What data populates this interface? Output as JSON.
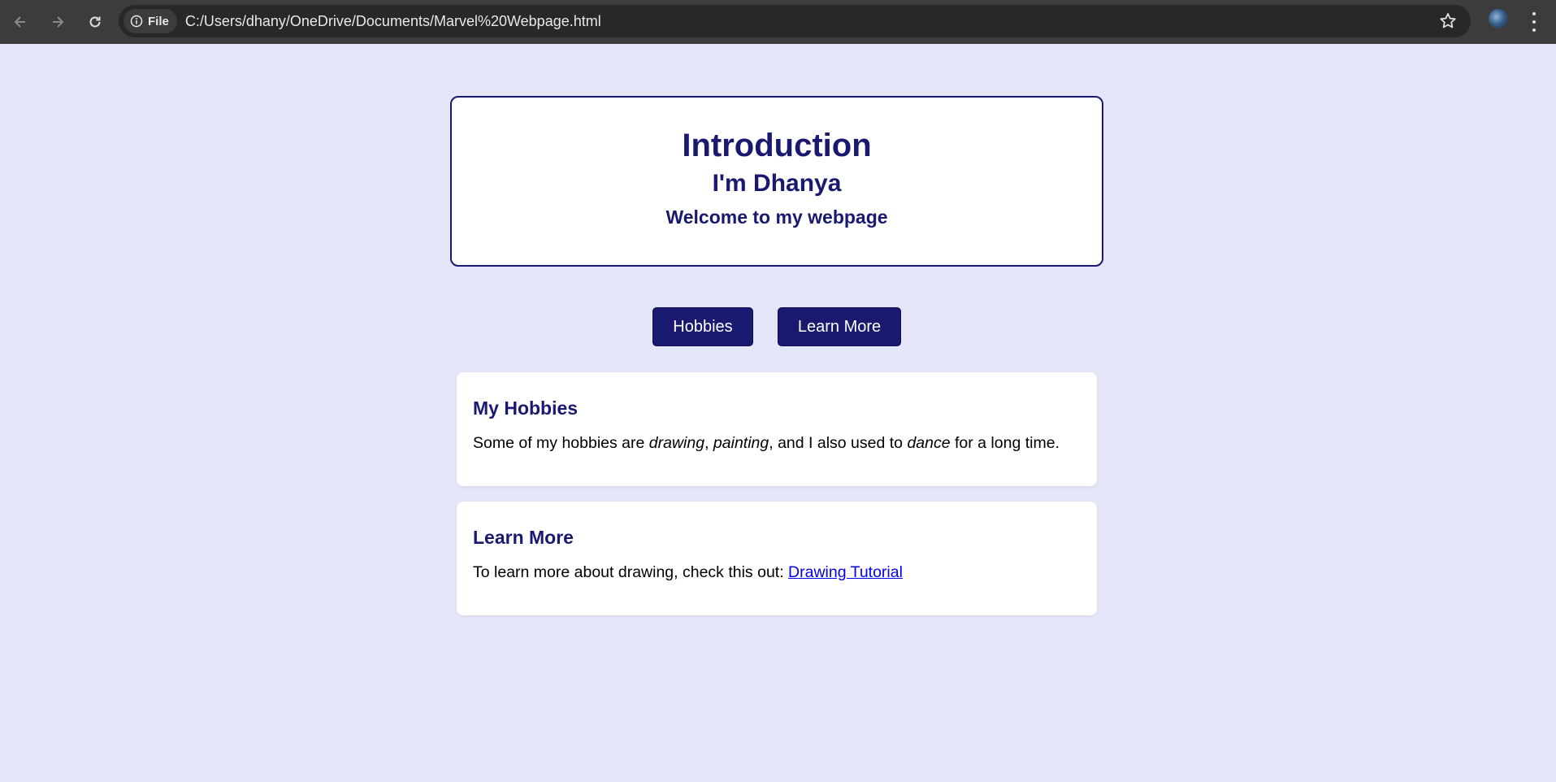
{
  "browser": {
    "back_icon": "arrow-left-icon",
    "forward_icon": "arrow-right-icon",
    "reload_icon": "reload-icon",
    "site_chip_label": "File",
    "url": "C:/Users/dhany/OneDrive/Documents/Marvel%20Webpage.html",
    "bookmark_icon": "star-icon",
    "menu_icon": "kebab-menu-icon"
  },
  "intro": {
    "title": "Introduction",
    "subtitle": "I'm Dhanya",
    "tagline": "Welcome to my webpage"
  },
  "buttons": {
    "hobbies": "Hobbies",
    "learn_more": "Learn More"
  },
  "hobbies": {
    "heading": "My Hobbies",
    "text_1": "Some of my hobbies are ",
    "em_1": "drawing",
    "text_2": ", ",
    "em_2": "painting",
    "text_3": ", and I also used to ",
    "em_3": "dance",
    "text_4": " for a long time."
  },
  "learn_more": {
    "heading": "Learn More",
    "text": "To learn more about drawing, check this out: ",
    "link": "Drawing Tutorial"
  },
  "colors": {
    "page_bg": "#e6e6fa",
    "accent": "#191970",
    "link": "#0000ee"
  }
}
